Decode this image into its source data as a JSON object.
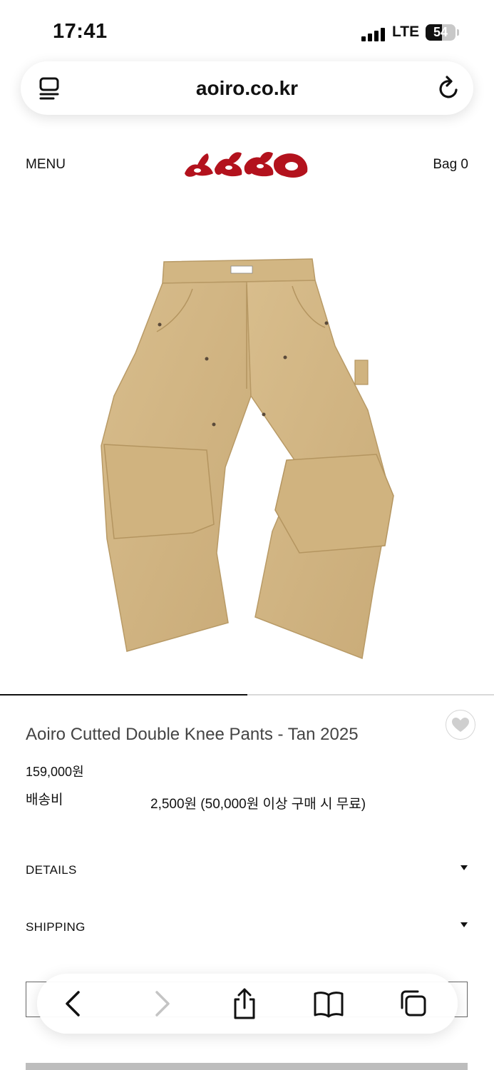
{
  "status_bar": {
    "time": "17:41",
    "network": "LTE",
    "battery_level": "54"
  },
  "browser": {
    "url": "aoiro.co.kr"
  },
  "site_header": {
    "menu_label": "MENU",
    "bag_label": "Bag 0",
    "brand_color": "#b3121d"
  },
  "product": {
    "image_description_icon": "tan-double-knee-pants-photo",
    "gallery_progress": 0.5,
    "title": "Aoiro Cutted Double Knee Pants - Tan 2025",
    "price": "159,000원",
    "shipping_label": "배송비",
    "shipping_value": "2,500원 (50,000원 이상 구매 시 무료)"
  },
  "sections": {
    "details": "DETAILS",
    "shipping": "SHIPPING"
  },
  "toolbar": {
    "icons": [
      "back-icon",
      "forward-icon",
      "share-icon",
      "bookmarks-icon",
      "tabs-icon"
    ]
  }
}
